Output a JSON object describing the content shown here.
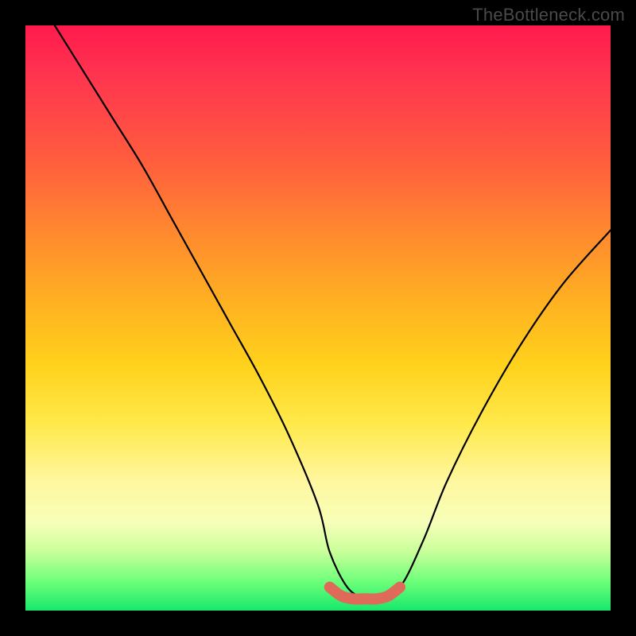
{
  "watermark": "TheBottleneck.com",
  "chart_data": {
    "type": "line",
    "title": "",
    "xlabel": "",
    "ylabel": "",
    "xlim": [
      0,
      100
    ],
    "ylim": [
      0,
      100
    ],
    "grid": false,
    "legend": false,
    "series": [
      {
        "name": "black-curve",
        "color": "#000000",
        "x": [
          5,
          10,
          15,
          20,
          25,
          30,
          35,
          40,
          45,
          50,
          52,
          55,
          58,
          60,
          64,
          68,
          72,
          78,
          85,
          92,
          100
        ],
        "y": [
          100,
          92,
          84,
          76,
          67,
          58,
          49,
          40,
          30,
          18,
          10,
          4,
          2,
          2,
          4,
          12,
          22,
          34,
          46,
          56,
          65
        ]
      },
      {
        "name": "red-band",
        "color": "#e06a5a",
        "x": [
          52,
          54,
          56,
          58,
          60,
          62,
          64
        ],
        "y": [
          4,
          2.5,
          2,
          2,
          2,
          2.5,
          4
        ]
      }
    ],
    "background_gradient": {
      "stops": [
        {
          "pos": 0.0,
          "color": "#ff1a4d"
        },
        {
          "pos": 0.22,
          "color": "#ff5a3f"
        },
        {
          "pos": 0.48,
          "color": "#ffb321"
        },
        {
          "pos": 0.68,
          "color": "#ffe94a"
        },
        {
          "pos": 0.85,
          "color": "#f7ffb8"
        },
        {
          "pos": 0.95,
          "color": "#6eff7a"
        },
        {
          "pos": 1.0,
          "color": "#17e86b"
        }
      ]
    }
  }
}
